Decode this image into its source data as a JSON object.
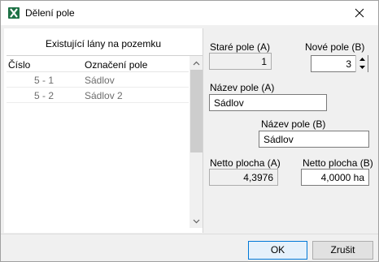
{
  "window": {
    "title": "Dělení pole"
  },
  "left": {
    "heading": "Existující lány na pozemku",
    "columns": [
      "Číslo",
      "Označení pole"
    ],
    "rows": [
      {
        "cislo": "5 - 1",
        "oznaceni": "Sádlov"
      },
      {
        "cislo": "5 - 2",
        "oznaceni": "Sádlov 2"
      }
    ]
  },
  "right": {
    "old_field_label": "Staré pole (A)",
    "old_field_value": "1",
    "new_field_label": "Nové pole (B)",
    "new_field_value": "3",
    "name_a_label": "Název pole (A)",
    "name_a_value": "Sádlov",
    "name_b_label": "Název pole (B)",
    "name_b_value": "Sádlov",
    "area_a_label": "Netto plocha (A)",
    "area_a_value": "4,3976",
    "area_b_label": "Netto plocha (B)",
    "area_b_value": "4,0000 ha"
  },
  "buttons": {
    "ok": "OK",
    "cancel": "Zrušit"
  },
  "icons": {
    "app": "excel-icon",
    "close": "close-icon"
  }
}
